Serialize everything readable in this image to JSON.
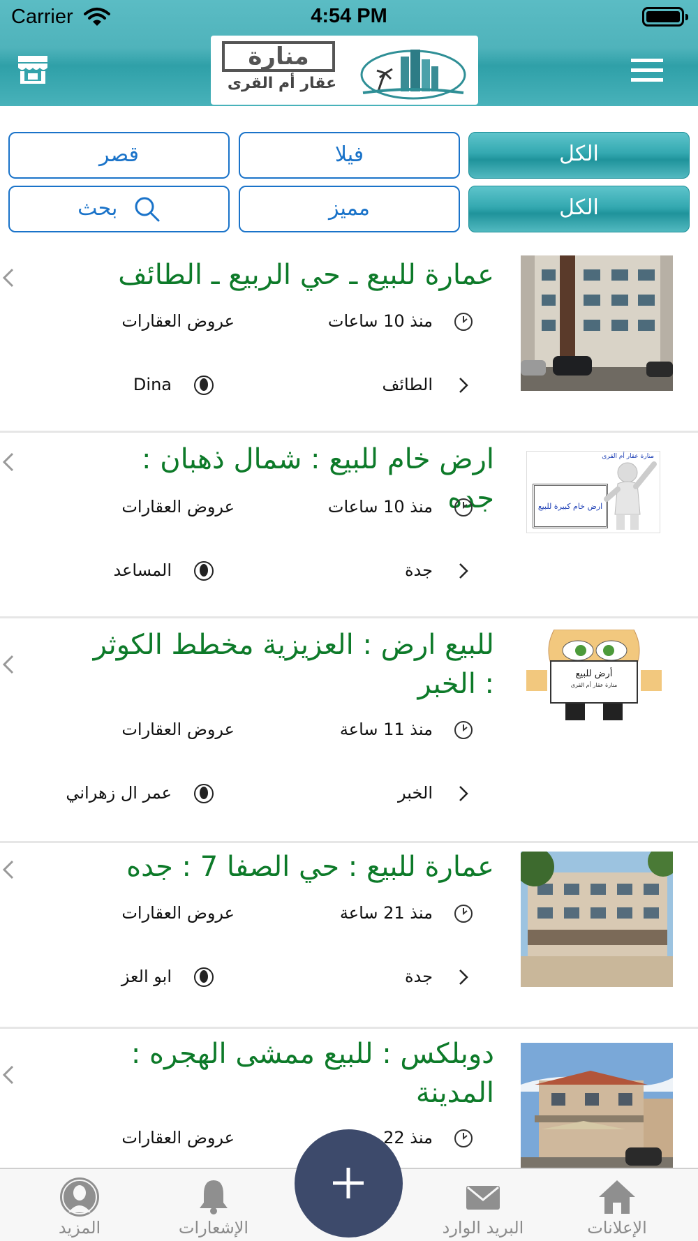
{
  "status_bar": {
    "carrier": "Carrier",
    "time": "4:54 PM"
  },
  "header": {
    "logo_word": "منارة",
    "logo_subtitle": "عقار أم القرى"
  },
  "filters": {
    "row1": [
      {
        "label": "الكل",
        "active": true
      },
      {
        "label": "فيلا",
        "active": false
      },
      {
        "label": "قصر",
        "active": false
      }
    ],
    "row2": [
      {
        "label": "الكل",
        "active": true
      },
      {
        "label": "مميز",
        "active": false
      },
      {
        "label": "بحث",
        "active": false
      }
    ]
  },
  "listings": [
    {
      "title": "عمارة للبيع ـ حي الربيع ـ الطائف",
      "time": "منذ 10 ساعات",
      "category": "عروض العقارات",
      "city": "الطائف",
      "user": "Dina",
      "image": "building-photo"
    },
    {
      "title": "ارض خام للبيع : شمال ذهبان : جده",
      "time": "منذ 10 ساعات",
      "category": "عروض العقارات",
      "city": "جدة",
      "user": "المساعد",
      "image": "land-sign-illustration",
      "image_texts": [
        "منارة عقار أم القرى",
        "ارض خام كبيرة للبيع"
      ]
    },
    {
      "title": "للبيع ارض : العزيزية مخطط الكوثر : الخبر",
      "time": "منذ 11 ساعة",
      "category": "عروض العقارات",
      "city": "الخبر",
      "user": "عمر ال زهراني",
      "image": "cartoon-sign",
      "image_texts": [
        "أرض للبيع",
        "منارة عقار أم القرى"
      ]
    },
    {
      "title": "عمارة للبيع : حي الصفا 7 : جده",
      "time": "منذ 21 ساعة",
      "category": "عروض العقارات",
      "city": "جدة",
      "user": "ابو العز",
      "image": "building-photo"
    },
    {
      "title": "دوبلكس : للبيع ممشى الهجره : المدينة",
      "time": "منذ 22",
      "category": "عروض العقارات",
      "city": "",
      "user": "",
      "image": "duplex-photo"
    }
  ],
  "tabbar": {
    "tabs": [
      {
        "label": "المزيد",
        "icon": "profile-icon"
      },
      {
        "label": "الإشعارات",
        "icon": "bell-icon"
      },
      {
        "label": "البريد الوارد",
        "icon": "mail-icon"
      },
      {
        "label": "الإعلانات",
        "icon": "home-icon"
      }
    ],
    "fab_icon": "plus-icon"
  }
}
